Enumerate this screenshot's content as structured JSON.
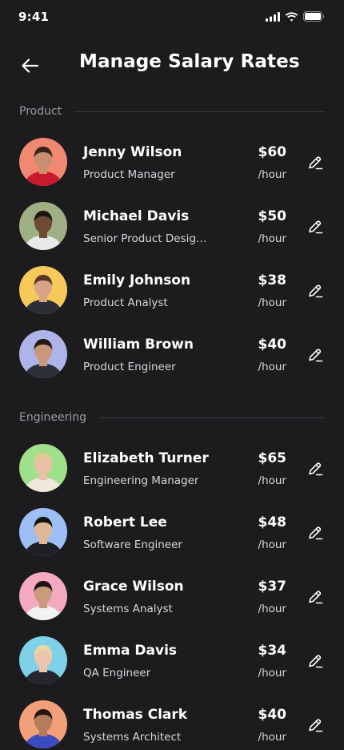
{
  "status_bar": {
    "time": "9:41"
  },
  "header": {
    "title": "Manage Salary Rates"
  },
  "sections": [
    {
      "label": "Product",
      "people": [
        {
          "name": "Jenny Wilson",
          "role": "Product Manager",
          "rate": "$60",
          "unit": "/hour",
          "avatar_bg": "#f08872",
          "skin": "#c98e72",
          "hair": "#3a2218",
          "shirt": "#c8192e"
        },
        {
          "name": "Michael Davis",
          "role": "Senior Product Design...",
          "rate": "$50",
          "unit": "/hour",
          "avatar_bg": "#9fb084",
          "skin": "#6e4a34",
          "hair": "#1f1510",
          "shirt": "#e8e8e8"
        },
        {
          "name": "Emily Johnson",
          "role": "Product Analyst",
          "rate": "$38",
          "unit": "/hour",
          "avatar_bg": "#f6c95a",
          "skin": "#d7a485",
          "hair": "#5a3624",
          "shirt": "#2b2e35"
        },
        {
          "name": "William Brown",
          "role": "Product Engineer",
          "rate": "$40",
          "unit": "/hour",
          "avatar_bg": "#aeb3ea",
          "skin": "#c9987a",
          "hair": "#241914",
          "shirt": "#2c3138"
        }
      ]
    },
    {
      "label": "Engineering",
      "people": [
        {
          "name": "Elizabeth Turner",
          "role": "Engineering Manager",
          "rate": "$65",
          "unit": "/hour",
          "avatar_bg": "#9fe08a",
          "skin": "#e7c1a6",
          "hair": "#e2c98f",
          "shirt": "#f0e6da"
        },
        {
          "name": "Robert Lee",
          "role": "Software Engineer",
          "rate": "$48",
          "unit": "/hour",
          "avatar_bg": "#9dbff5",
          "skin": "#e0b896",
          "hair": "#151515",
          "shirt": "#1e1f24"
        },
        {
          "name": "Grace Wilson",
          "role": "Systems Analyst",
          "rate": "$37",
          "unit": "/hour",
          "avatar_bg": "#f3a9bf",
          "skin": "#c99a7c",
          "hair": "#1e1411",
          "shirt": "#f2f2f2"
        },
        {
          "name": "Emma Davis",
          "role": "QA Engineer",
          "rate": "$34",
          "unit": "/hour",
          "avatar_bg": "#7fd0e9",
          "skin": "#ecc6ae",
          "hair": "#e8d6a4",
          "shirt": "#24262c"
        },
        {
          "name": "Thomas Clark",
          "role": "Systems Architect",
          "rate": "$40",
          "unit": "/hour",
          "avatar_bg": "#f2a07a",
          "skin": "#b47c5c",
          "hair": "#24160f",
          "shirt": "#3b4cc0"
        }
      ]
    }
  ],
  "icons": {
    "back": "arrow-left-icon",
    "edit": "pencil-edit-icon",
    "signal": "signal-icon",
    "wifi": "wifi-icon",
    "battery": "battery-icon"
  }
}
